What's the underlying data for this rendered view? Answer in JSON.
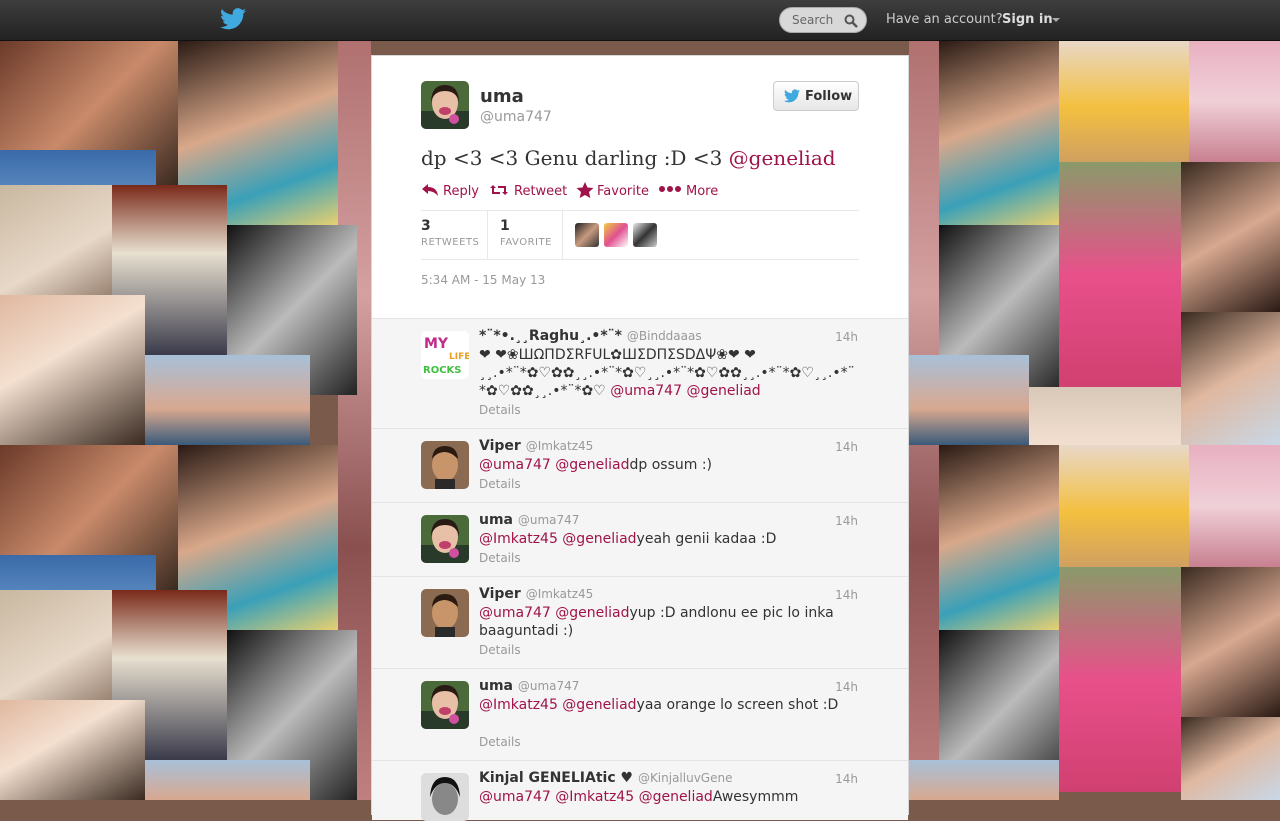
{
  "topbar": {
    "logo_icon": "twitter-bird-icon",
    "search_placeholder": "Search",
    "search_icon": "magnifier-icon",
    "have_account": "Have an account?",
    "sign_in": "Sign in"
  },
  "colors": {
    "accent": "#a0134a",
    "topbar": "#2b2b2b",
    "bird": "#3fa9e0"
  },
  "tweet": {
    "name": "uma",
    "handle": "@uma747",
    "follow_label": "Follow",
    "text_prefix": "dp <3 <3 Genu darling :D <3 ",
    "text_mention": "@geneliad",
    "actions": {
      "reply": "Reply",
      "retweet": "Retweet",
      "favorite": "Favorite",
      "more": "More"
    },
    "retweets_count": "3",
    "retweets_label": "RETWEETS",
    "favorites_count": "1",
    "favorites_label": "FAVORITE",
    "timestamp": "5:34 AM - 15 May 13"
  },
  "replies": [
    {
      "name": "*¨*•.¸¸Raghu¸.•*¨*",
      "handle": "@Binddaaas",
      "time": "14h",
      "text": "❤ ❤❀ШΩΠDΣRFUL✿ШΣDΠΣSDΔΨ❀❤ ❤ ¸¸.•*¨*✿♡✿✿¸¸.•*¨*✿♡¸¸.•*¨*✿♡✿✿¸¸.•*¨*✿♡¸¸.•*¨*✿♡✿✿¸¸.•*¨*✿♡ ",
      "mentions": "@uma747 @geneliad",
      "details": "Details"
    },
    {
      "name": "Viper",
      "handle": "@Imkatz45",
      "time": "14h",
      "mentions": "@uma747 @geneliad",
      "text": "dp ossum :)",
      "details": "Details"
    },
    {
      "name": "uma",
      "handle": "@uma747",
      "time": "14h",
      "mentions": "@Imkatz45 @geneliad",
      "text": "yeah genii kadaa :D",
      "details": "Details"
    },
    {
      "name": "Viper",
      "handle": "@Imkatz45",
      "time": "14h",
      "mentions": "@uma747 @geneliad",
      "text": "yup :D andlonu ee pic lo inka baaguntadi :)",
      "details": "Details"
    },
    {
      "name": "uma",
      "handle": "@uma747",
      "time": "14h",
      "mentions": "@Imkatz45 @geneliad",
      "text": "yaa orange lo screen shot :D",
      "details": "Details"
    },
    {
      "name": "Kinjal GENELIAtic ♥",
      "handle": "@KinjalluvGene",
      "time": "14h",
      "mentions": "@uma747 @Imkatz45 @geneliad",
      "text": "Awesymmm",
      "details": ""
    }
  ]
}
